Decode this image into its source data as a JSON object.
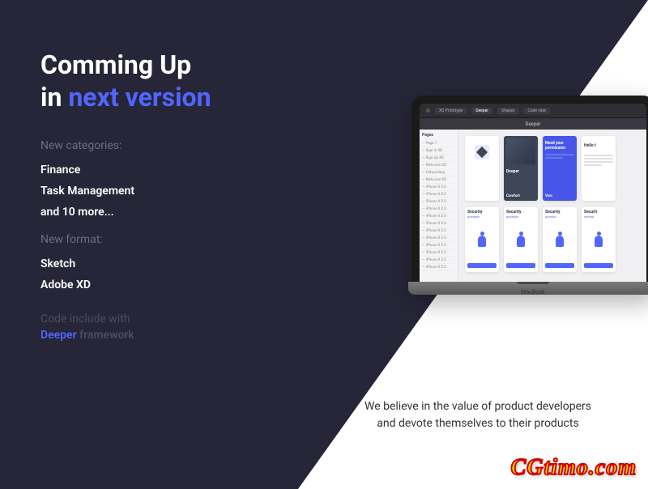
{
  "heading": {
    "line1": "Comming Up",
    "line2_prefix": "in ",
    "line2_accent": "next version"
  },
  "sections": {
    "categories": {
      "label": "New categories:",
      "items": [
        "Finance",
        "Task Management",
        "and 10 more..."
      ]
    },
    "format": {
      "label": "New format:",
      "items": [
        "Sketch",
        "Adobe XD"
      ]
    },
    "code": {
      "label": "Code include with",
      "accent": "Deeper",
      "suffix": " framework"
    }
  },
  "laptop": {
    "brand": "MacBook",
    "menubar_tabs": [
      "XD Prototype",
      "Deeper",
      "Shapes",
      "Code view"
    ],
    "toolbar_label": "Deeper",
    "sidepanel": {
      "title": "Pages",
      "items": [
        "Page 1",
        "Sign In XD",
        "Sign Up XD",
        "Welcome XD",
        "Onboarding",
        "Welcome XD",
        "iPhone X 2.0",
        "iPhone X 2.0",
        "iPhone X 2.0",
        "iPhone X 2.0",
        "iPhone X 2.0",
        "iPhone X 2.0",
        "iPhone X 2.0",
        "iPhone X 2.0",
        "iPhone X 2.0",
        "iPhone X 2.0",
        "iPhone X 2.0",
        "iPhone X 2.0"
      ]
    },
    "mockups_row1": [
      {
        "type": "logo"
      },
      {
        "type": "dark",
        "title": "Deeper"
      },
      {
        "type": "blue",
        "title": "Need your permission"
      },
      {
        "type": "whiteform",
        "title": "Hello t"
      }
    ],
    "mockups_row1_bottom": [
      "Comfort",
      "Voic"
    ],
    "mockups_row2": [
      {
        "title": "Security",
        "sub": "question"
      },
      {
        "title": "Security",
        "sub": "question"
      },
      {
        "title": "Security",
        "sub": "questio"
      },
      {
        "title": "Securit",
        "sub": "setting"
      }
    ]
  },
  "tagline": {
    "line1": "We believe in the value of product developers",
    "line2": "and devote themselves to their products"
  },
  "watermark": "CGtimo.com"
}
